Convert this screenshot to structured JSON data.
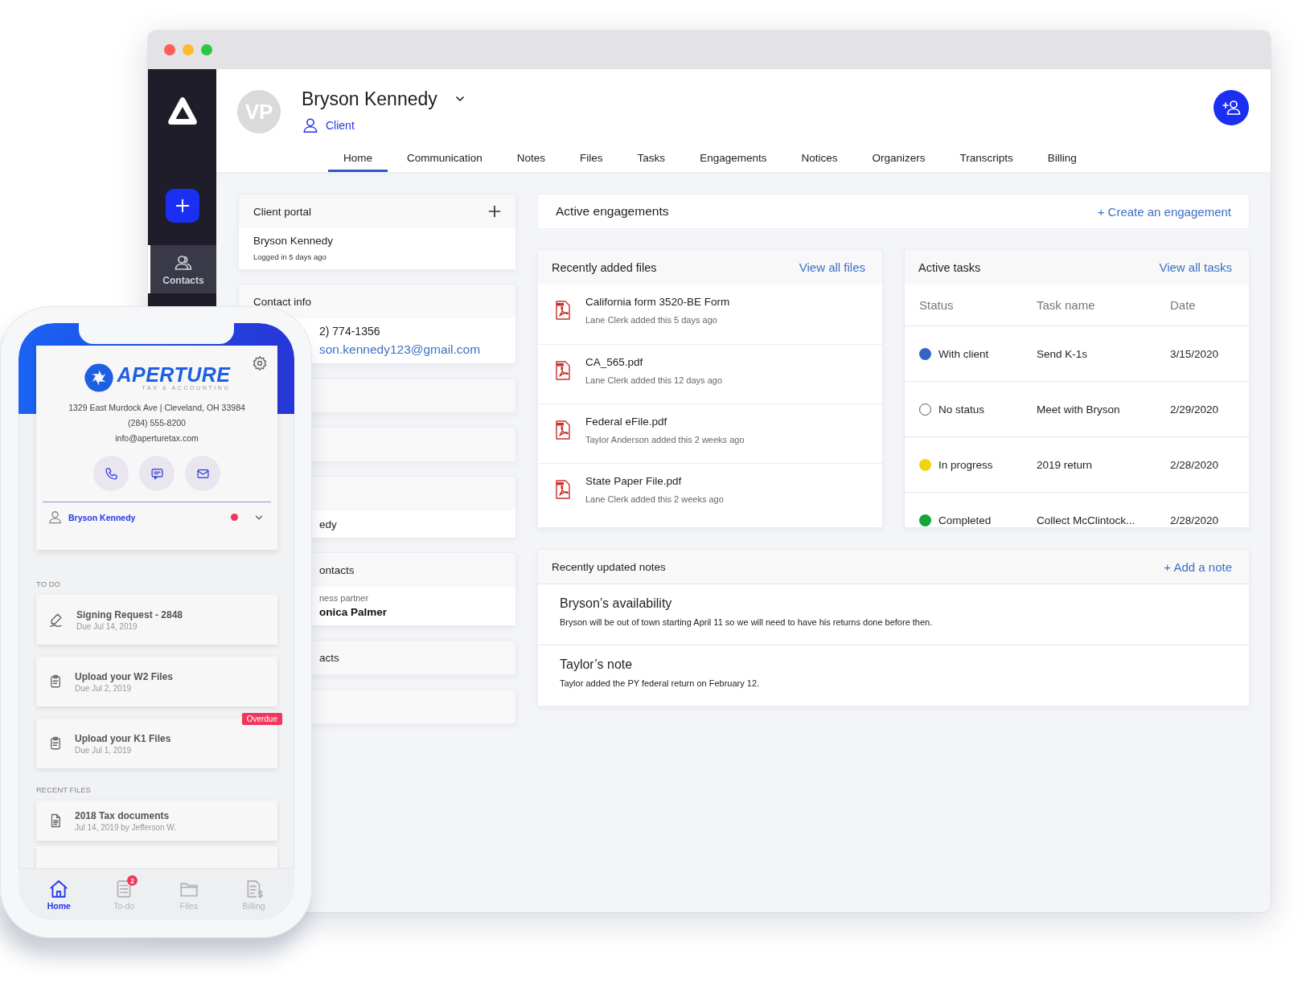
{
  "sidebar": {
    "items": [
      {
        "label": "Contacts",
        "selected": true
      }
    ]
  },
  "client": {
    "initials": "VP",
    "name": "Bryson Kennedy",
    "role": "Client"
  },
  "tabs": [
    {
      "label": "Home",
      "selected": true
    },
    {
      "label": "Communication",
      "selected": false
    },
    {
      "label": "Notes",
      "selected": false
    },
    {
      "label": "Files",
      "selected": false
    },
    {
      "label": "Tasks",
      "selected": false
    },
    {
      "label": "Engagements",
      "selected": false
    },
    {
      "label": "Notices",
      "selected": false
    },
    {
      "label": "Organizers",
      "selected": false
    },
    {
      "label": "Transcripts",
      "selected": false
    },
    {
      "label": "Billing",
      "selected": false
    }
  ],
  "client_portal": {
    "title": "Client portal",
    "name": "Bryson Kennedy",
    "status": "Logged in 5 days ago"
  },
  "contact_info": {
    "title": "Contact info",
    "phone": "2) 774-1356",
    "email": "son.kennedy123@gmail.com"
  },
  "left_cards": [
    {
      "kind": "blank"
    },
    {
      "kind": "blank"
    },
    {
      "kind": "value",
      "value": "edy"
    },
    {
      "kind": "detail",
      "title": "ontacts",
      "label": "ness partner",
      "value": "onica Palmer"
    },
    {
      "kind": "title",
      "title": "acts"
    },
    {
      "kind": "blank"
    }
  ],
  "engagements": {
    "title": "Active engagements",
    "action": "+ Create an engagement"
  },
  "files": {
    "title": "Recently added files",
    "action": "View all files",
    "items": [
      {
        "name": "California form 3520-BE Form",
        "meta": "Lane Clerk added this 5 days ago"
      },
      {
        "name": "CA_565.pdf",
        "meta": "Lane Clerk added this 12 days ago"
      },
      {
        "name": "Federal eFile.pdf",
        "meta": "Taylor Anderson added this 2 weeks ago"
      },
      {
        "name": "State Paper File.pdf",
        "meta": "Lane Clerk added this 2 weeks ago"
      }
    ]
  },
  "tasks": {
    "title": "Active tasks",
    "action": "View all tasks",
    "columns": [
      "Status",
      "Task name",
      "Date"
    ],
    "rows": [
      {
        "kind": "filled",
        "color": "#3565c4",
        "status": "With client",
        "task": "Send K-1s",
        "date": "3/15/2020"
      },
      {
        "kind": "empty",
        "status": "No status",
        "task": "Meet with Bryson",
        "date": "2/29/2020"
      },
      {
        "kind": "filled",
        "color": "#f0d410",
        "status": "In progress",
        "task": "2019 return",
        "date": "2/28/2020"
      },
      {
        "kind": "filled",
        "color": "#17a535",
        "status": "Completed",
        "task": "Collect McClintock...",
        "date": "2/28/2020"
      }
    ]
  },
  "notes": {
    "title": "Recently updated notes",
    "action": "+ Add a note",
    "items": [
      {
        "title": "Bryson’s availability",
        "text": "Bryson will be out of town starting April 11 so we will need to have his returns done before then."
      },
      {
        "title": "Taylor’s note",
        "text": "Taylor added the PY federal return on February 12."
      }
    ]
  },
  "phone": {
    "brand": "APERTURE",
    "tagline": "TAX & ACCOUNTING",
    "address": "1329 East Murdock Ave | Cleveland, OH 33984",
    "phone": "(284) 555-8200",
    "email": "info@aperturetax.com",
    "user": {
      "name": "Bryson Kennedy",
      "alert": true
    },
    "todo_title": "TO DO",
    "todos": [
      {
        "kind": "signature",
        "title": "Signing Request - 2848",
        "due": "Due Jul 14, 2019"
      },
      {
        "kind": "upload",
        "title": "Upload your W2 Files",
        "due": "Due Jul 2, 2019"
      },
      {
        "kind": "upload",
        "title": "Upload your K1 Files",
        "due": "Due Jul 1, 2019",
        "badge": "Overdue"
      }
    ],
    "files_title": "RECENT FILES",
    "files": [
      {
        "title": "2018 Tax documents",
        "meta": "Jul 14, 2019 by Jefferson W."
      }
    ],
    "nav": [
      {
        "kind": "home",
        "label": "Home",
        "selected": true
      },
      {
        "kind": "todo",
        "label": "To-do",
        "selected": false,
        "badge": "2"
      },
      {
        "kind": "files",
        "label": "Files",
        "selected": false
      },
      {
        "kind": "billing",
        "label": "Billing",
        "selected": false
      }
    ]
  }
}
